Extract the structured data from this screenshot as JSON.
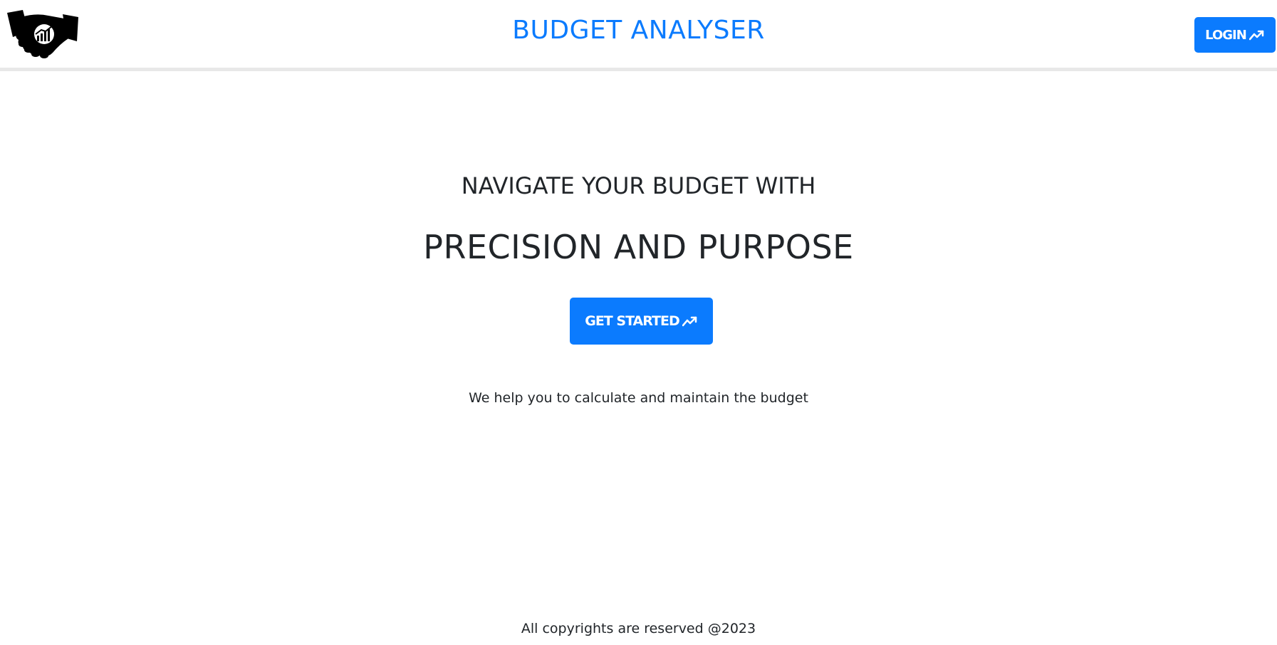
{
  "header": {
    "logo_icon": "handshake-icon",
    "title": "BUDGET ANALYSER",
    "login_label": "LOGIN",
    "login_icon": "trending-up-icon"
  },
  "hero": {
    "tagline": "NAVIGATE YOUR BUDGET WITH",
    "headline": "PRECISION AND PURPOSE",
    "cta_label": "GET STARTED",
    "cta_icon": "trending-up-icon",
    "description": "We help you to calculate and maintain the budget"
  },
  "footer": {
    "copyright": "All copyrights are reserved @2023"
  },
  "colors": {
    "accent": "#0b7bfe",
    "text": "#212529",
    "divider": "#e8e8e8"
  }
}
